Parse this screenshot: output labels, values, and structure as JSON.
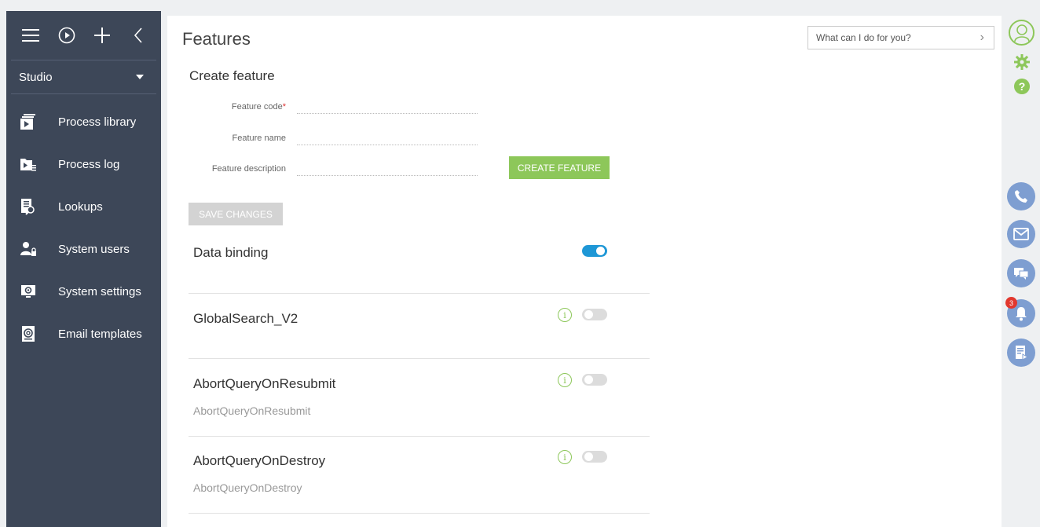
{
  "sidebar": {
    "studio_label": "Studio",
    "items": [
      {
        "label": "Process library",
        "icon": "process-library-icon"
      },
      {
        "label": "Process log",
        "icon": "process-log-icon"
      },
      {
        "label": "Lookups",
        "icon": "lookups-icon"
      },
      {
        "label": "System users",
        "icon": "system-users-icon"
      },
      {
        "label": "System settings",
        "icon": "system-settings-icon"
      },
      {
        "label": "Email templates",
        "icon": "email-templates-icon"
      }
    ]
  },
  "header": {
    "title": "Features",
    "search_placeholder": "What can I do for you?"
  },
  "create_form": {
    "title": "Create feature",
    "code_label": "Feature code",
    "required_mark": "*",
    "name_label": "Feature name",
    "description_label": "Feature description",
    "create_button": "CREATE FEATURE",
    "save_button": "SAVE CHANGES"
  },
  "features": [
    {
      "name": "Data binding",
      "description": "",
      "enabled": true,
      "has_info": false
    },
    {
      "name": "GlobalSearch_V2",
      "description": "",
      "enabled": false,
      "has_info": true
    },
    {
      "name": "AbortQueryOnResubmit",
      "description": "AbortQueryOnResubmit",
      "enabled": false,
      "has_info": true
    },
    {
      "name": "AbortQueryOnDestroy",
      "description": "AbortQueryOnDestroy",
      "enabled": false,
      "has_info": true
    }
  ],
  "info_glyph": "i",
  "rail": {
    "help_glyph": "?",
    "notification_count": "3"
  },
  "colors": {
    "sidebar_bg": "#3d4758",
    "accent_green": "#8dc75a",
    "toggle_on": "#1e97d6",
    "comm_blue": "#7e9ed1",
    "badge_red": "#e2382e"
  }
}
